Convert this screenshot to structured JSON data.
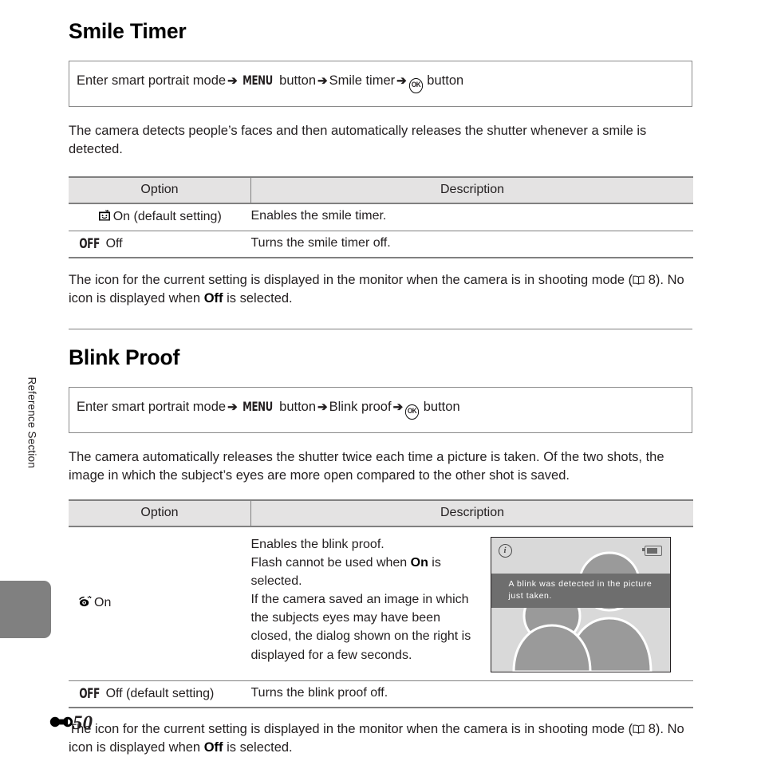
{
  "side_tab": {
    "label": "Reference Section"
  },
  "footer": {
    "page_prefix_icon": "reference-section-glyph",
    "page_number": "50"
  },
  "sections": [
    {
      "title": "Smile Timer",
      "path": {
        "lead": "Enter smart portrait mode",
        "arrow": "➔",
        "menu_label": "MENU",
        "button_word_1": "button",
        "item": "Smile timer",
        "ok_label": "OK",
        "button_word_2": "button"
      },
      "intro": "The camera detects people’s faces and then automatically releases the shutter whenever a smile is detected.",
      "table": {
        "headers": [
          "Option",
          "Description"
        ],
        "rows": [
          {
            "icon": "smile-timer-icon",
            "option": "On (default setting)",
            "description": "Enables the smile timer."
          },
          {
            "icon": "off-glyph",
            "icon_text": "OFF",
            "option": "Off",
            "description": "Turns the smile timer off."
          }
        ]
      },
      "note": {
        "part1": "The icon for the current setting is displayed in the monitor when the camera is in shooting mode (",
        "book_icon": "open-book-icon",
        "page_ref": "8",
        "part2": "). No icon is displayed when ",
        "bold_word": "Off",
        "part3": " is selected."
      }
    },
    {
      "title": "Blink Proof",
      "path": {
        "lead": "Enter smart portrait mode",
        "arrow": "➔",
        "menu_label": "MENU",
        "button_word_1": "button",
        "item": "Blink proof",
        "ok_label": "OK",
        "button_word_2": "button"
      },
      "intro": "The camera automatically releases the shutter twice each time a picture is taken. Of the two shots, the image in which the subject’s eyes are more open compared to the other shot is saved.",
      "table": {
        "headers": [
          "Option",
          "Description"
        ],
        "rows": [
          {
            "icon": "blink-proof-eye-icon",
            "option": "On",
            "description": "Enables the blink proof.\nFlash cannot be used when On is selected.\nIf the camera saved an image in which the subjects eyes may have been closed, the dialog shown on the right is displayed for a few seconds.",
            "description_lines": [
              "Enables the blink proof.",
              "Flash cannot be used when ",
              "On",
              " is selected.",
              "If the camera saved an image in which the subjects eyes may have been closed, the dialog shown on the right is displayed for a few seconds."
            ]
          },
          {
            "icon": "off-glyph",
            "icon_text": "OFF",
            "option": "Off (default setting)",
            "description": "Turns the blink proof off."
          }
        ]
      },
      "note": {
        "part1": "The icon for the current setting is displayed in the monitor when the camera is in shooting mode (",
        "book_icon": "open-book-icon",
        "page_ref": "8",
        "part2": "). No icon is displayed when ",
        "bold_word": "Off",
        "part3": " is selected."
      }
    }
  ],
  "monitor": {
    "info_icon": "info-icon",
    "battery_icon": "battery-icon",
    "message": "A blink was detected in the picture just taken.",
    "colors": {
      "screen_bg": "#d9d9d9",
      "banner_bg": "#6e6e6e",
      "silhouette": "#9a9a9a",
      "outline": "#ffffff"
    }
  }
}
